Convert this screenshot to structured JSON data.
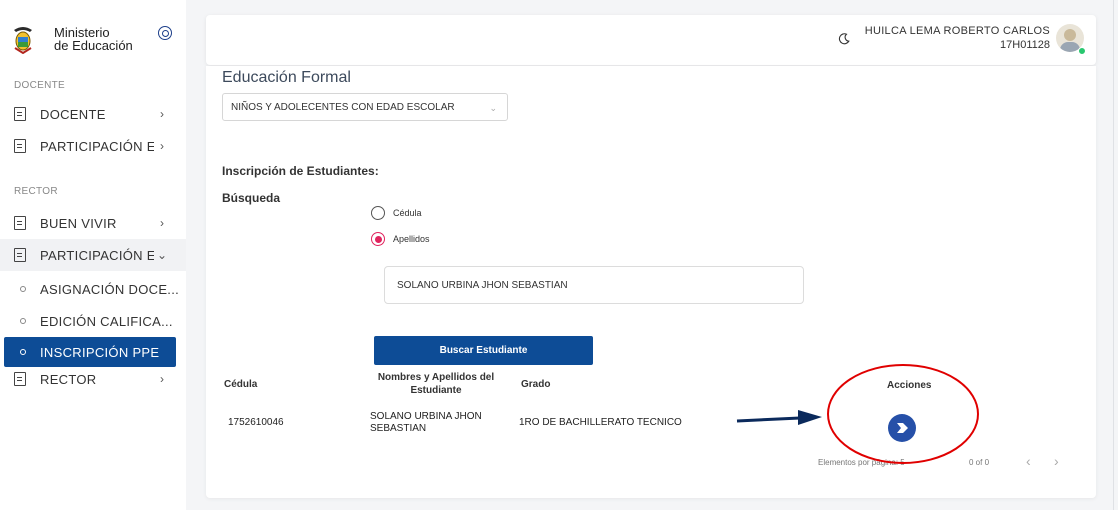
{
  "brand": {
    "line1": "Ministerio",
    "line2": "de Educación"
  },
  "sidebar": {
    "section_docente": "DOCENTE",
    "section_rector": "RECTOR",
    "items": [
      {
        "label": "DOCENTE",
        "chevron": "›"
      },
      {
        "label": "PARTICIPACIÓN ES...",
        "chevron": "›"
      },
      {
        "label": "BUEN VIVIR",
        "chevron": "›"
      },
      {
        "label": "PARTICIPACIÓN ES...",
        "chevron": "⌄"
      },
      {
        "label": "RECTOR",
        "chevron": "›"
      }
    ],
    "subitems": [
      {
        "label": "ASIGNACIÓN DOCE..."
      },
      {
        "label": "EDICIÓN CALIFICA..."
      },
      {
        "label": "INSCRIPCIÓN PPE"
      }
    ]
  },
  "topbar": {
    "user_name": "HUILCA LEMA ROBERTO CARLOS",
    "user_code": "17H01128"
  },
  "main": {
    "heading": "Educación Formal",
    "select_value": "NIÑOS Y ADOLECENTES CON EDAD ESCOLAR",
    "section_label": "Inscripción de Estudiantes:",
    "search_label": "Búsqueda",
    "radio_cedula": "Cédula",
    "radio_apellidos": "Apellidos",
    "search_value": "SOLANO URBINA JHON SEBASTIAN",
    "search_button": "Buscar Estudiante"
  },
  "table": {
    "headers": {
      "cedula": "Cédula",
      "nombres_1": "Nombres y Apellidos del",
      "nombres_2": "Estudiante",
      "grado": "Grado",
      "acciones": "Acciones"
    },
    "row": {
      "cedula": "1752610046",
      "nombre_1": "SOLANO URBINA JHON",
      "nombre_2": "SEBASTIAN",
      "grado": "1RO DE BACHILLERATO TECNICO"
    }
  },
  "pagination": {
    "items_label": "Elementos por página: 5",
    "range": "0 of 0",
    "prev": "‹",
    "next": "›"
  },
  "colors": {
    "primary": "#0d4c96",
    "annotation_red": "#e00000",
    "arrow_navy": "#0b2a5c",
    "radio_selected": "#e0245e"
  }
}
